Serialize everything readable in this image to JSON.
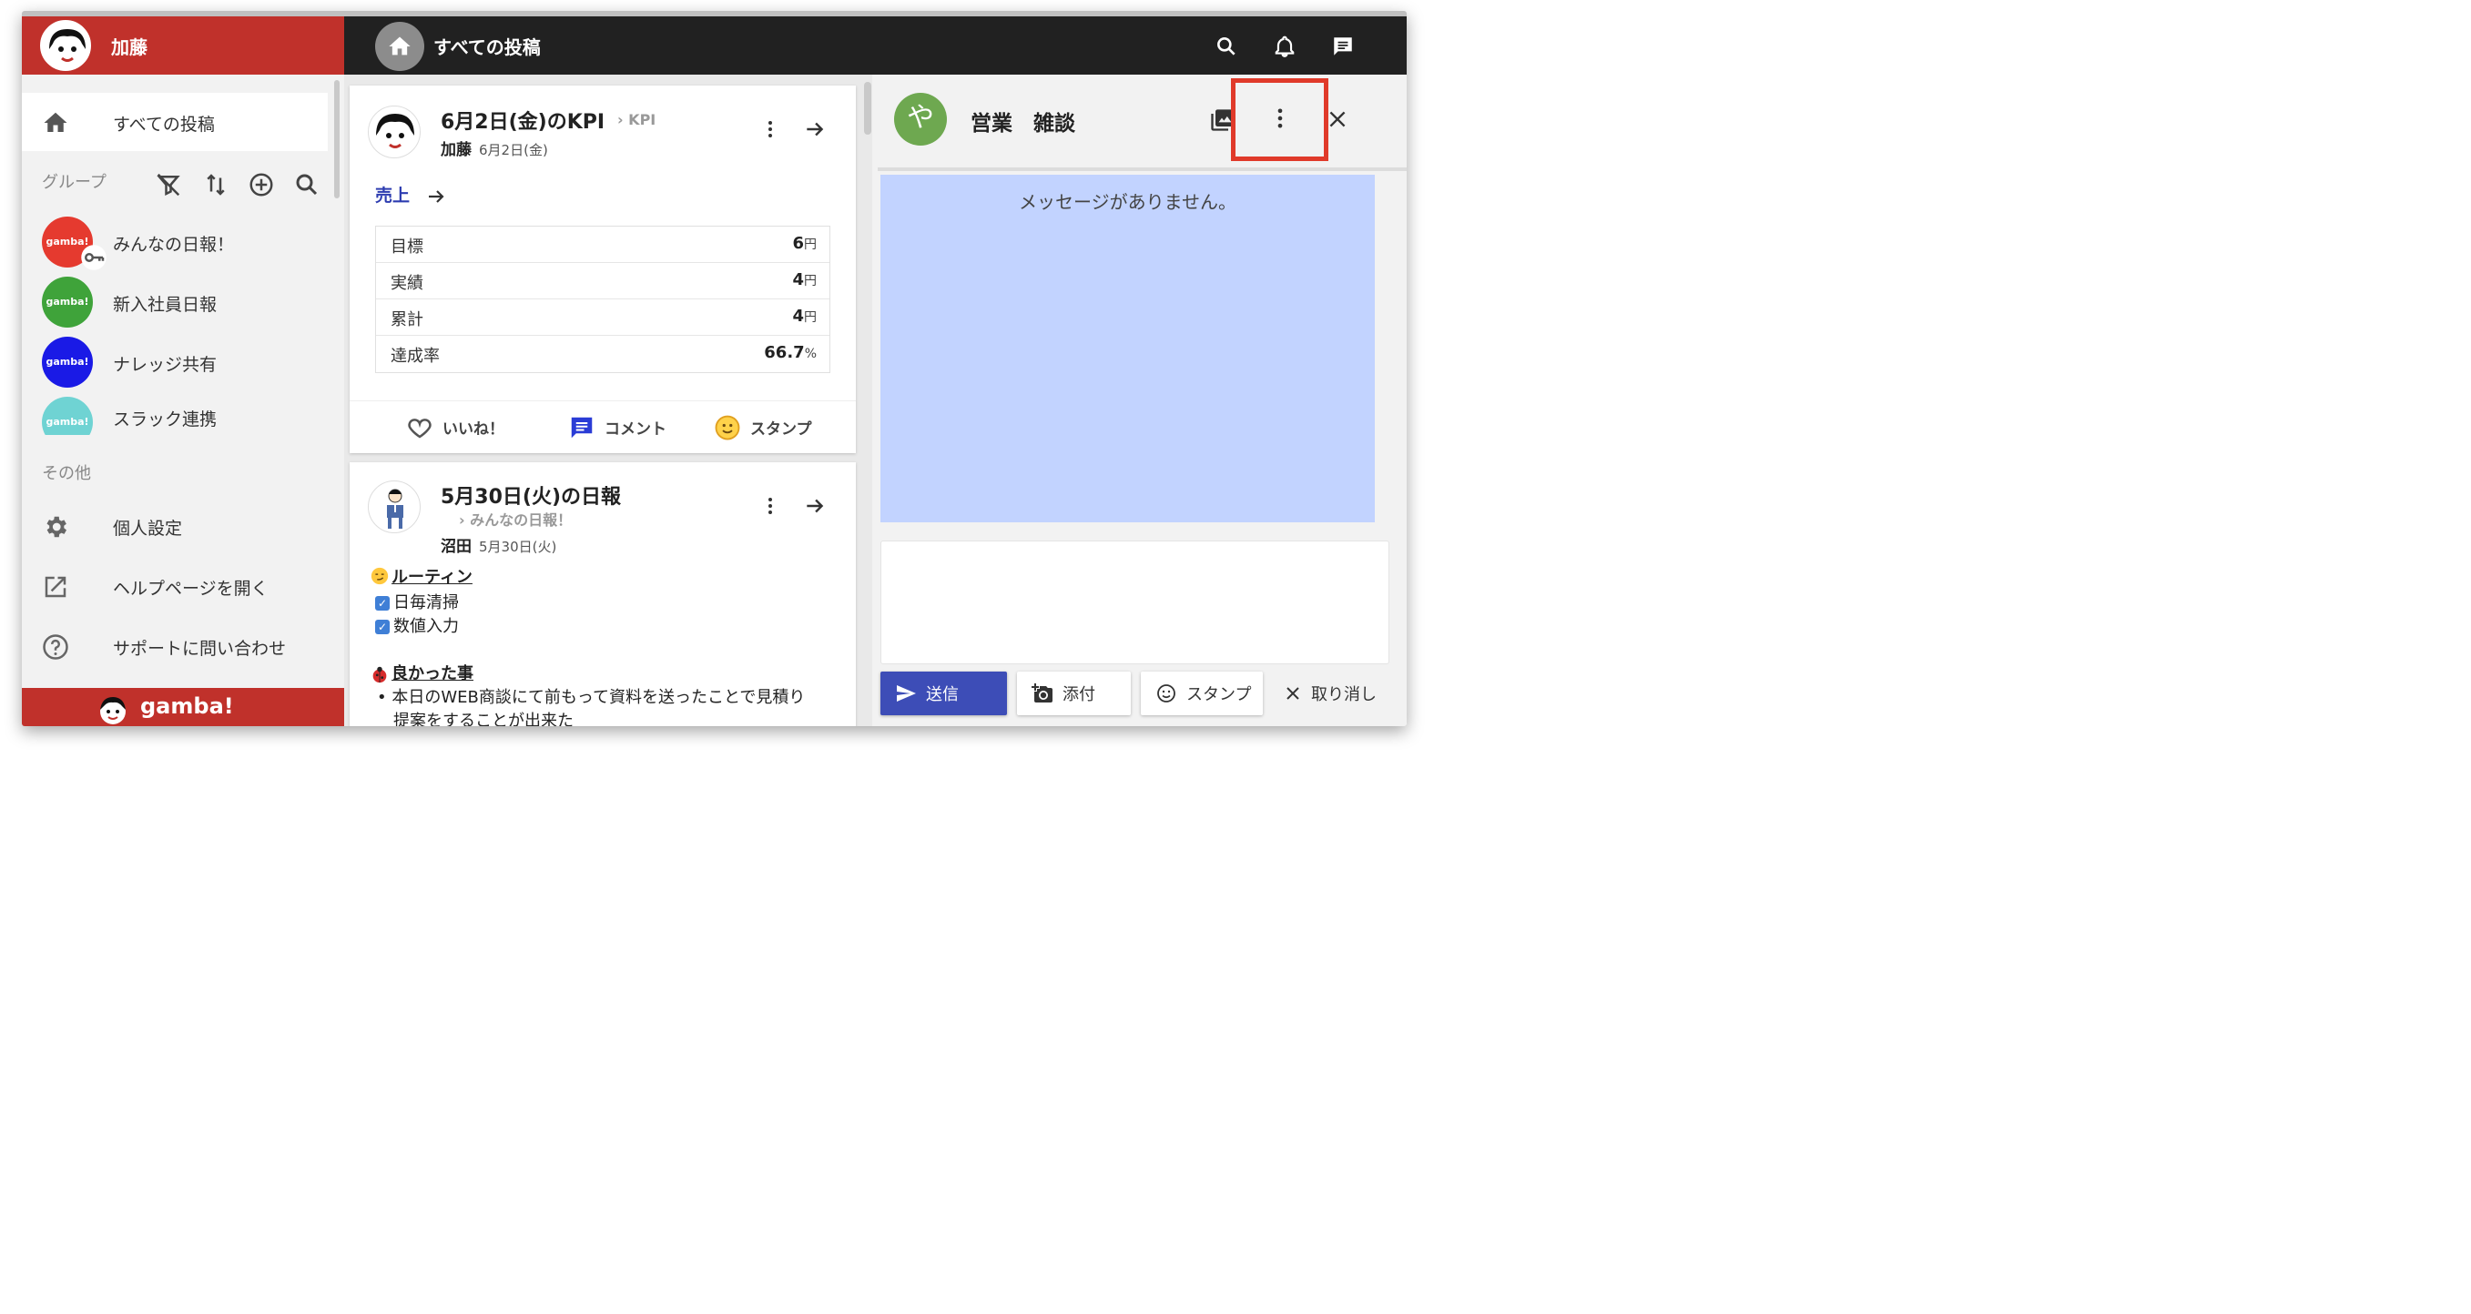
{
  "sidebar": {
    "user_name": "加藤",
    "nav_all_posts": "すべての投稿",
    "groups_label": "グループ",
    "groups": [
      {
        "label": "みんなの日報！",
        "badge": "gamba!",
        "color": "#e53a2f"
      },
      {
        "label": "新入社員日報",
        "badge": "gamba!",
        "color": "#3fa33a"
      },
      {
        "label": "ナレッジ共有",
        "badge": "gamba!",
        "color": "#1a1ae6"
      },
      {
        "label": "スラック連携",
        "badge": "gamba!",
        "color": "#6fd3d3"
      }
    ],
    "other_label": "その他",
    "other_items": [
      {
        "label": "個人設定",
        "icon": "gear-icon"
      },
      {
        "label": "ヘルプページを開く",
        "icon": "open-external-icon"
      },
      {
        "label": "サポートに問い合わせ",
        "icon": "help-circle-icon"
      }
    ],
    "brand": "gamba!"
  },
  "header": {
    "title": "すべての投稿"
  },
  "feed": {
    "post1": {
      "title": "6月2日(金)のKPI",
      "group": "KPI",
      "author": "加藤",
      "date": "6月2日(金)",
      "kpi_link": "売上",
      "kpi_rows": [
        {
          "name": "目標",
          "value": "6",
          "unit": "円"
        },
        {
          "name": "実績",
          "value": "4",
          "unit": "円"
        },
        {
          "name": "累計",
          "value": "4",
          "unit": "円"
        },
        {
          "name": "達成率",
          "value": "66.7",
          "unit": "%"
        }
      ],
      "actions": {
        "like": "いいね！",
        "comment": "コメント",
        "stamp": "スタンプ"
      }
    },
    "post2": {
      "title": "5月30日(火)の日報",
      "group": "みんなの日報！",
      "author": "沼田",
      "date": "5月30日(火)",
      "section1": "ルーティン",
      "checks": [
        "日毎清掃",
        "数値入力"
      ],
      "section2": "良かった事",
      "bullet": "本日のWEB商談にて前もって資料を送ったことで見積り",
      "bullet_cont": "提案をすることが出来た"
    }
  },
  "chat": {
    "avatar_char": "や",
    "title": "営業　雑談",
    "empty_message": "メッセージがありません。",
    "buttons": {
      "send": "送信",
      "attach": "添付",
      "stamp": "スタンプ",
      "cancel": "取り消し"
    }
  },
  "colors": {
    "brand_red": "#c0312b",
    "header_dark": "#212121",
    "message_area": "#c2d3ff",
    "send_button": "#3d4db7",
    "highlight": "#e03a2a"
  }
}
